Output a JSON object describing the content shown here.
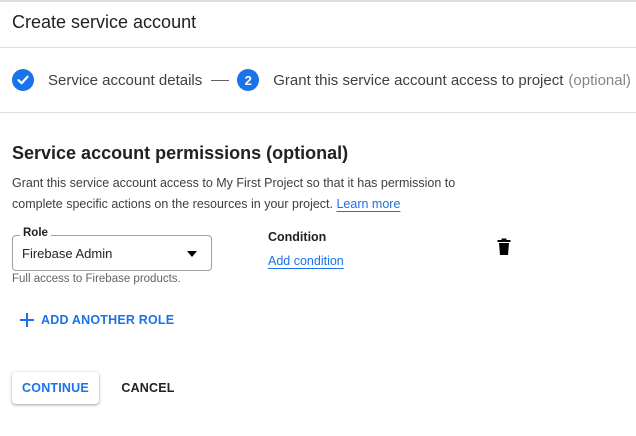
{
  "header": {
    "title": "Create service account"
  },
  "stepper": {
    "step1": {
      "label": "Service account details",
      "state": "completed",
      "icon": "check-icon"
    },
    "separator": "—",
    "step2": {
      "number": "2",
      "label": "Grant this service account access to project",
      "suffix": "(optional)",
      "state": "active"
    }
  },
  "section": {
    "title": "Service account permissions (optional)",
    "description": "Grant this service account access to My First Project so that it has permission to complete specific actions on the resources in your project.",
    "learn_more": "Learn more"
  },
  "role": {
    "label": "Role",
    "value": "Firebase Admin",
    "helper": "Full access to Firebase products."
  },
  "condition": {
    "label": "Condition",
    "add_link": "Add condition"
  },
  "actions": {
    "add_another_role": "ADD ANOTHER ROLE",
    "continue": "CONTINUE",
    "cancel": "CANCEL"
  },
  "colors": {
    "accent": "#1a73e8",
    "text": "#202124",
    "muted": "#5f6368",
    "divider": "#dadce0"
  }
}
